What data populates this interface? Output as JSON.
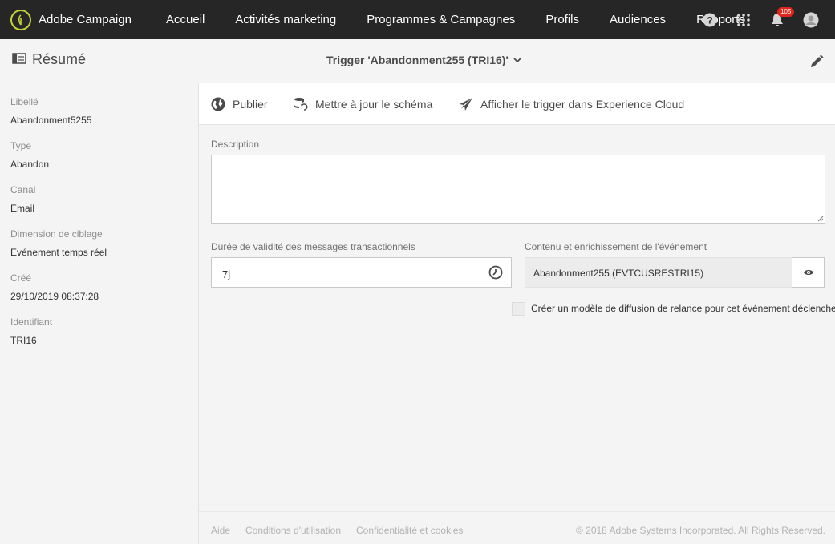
{
  "app": {
    "brand": "Adobe Campaign",
    "nav": [
      "Accueil",
      "Activités marketing",
      "Programmes & Campagnes",
      "Profils",
      "Audiences",
      "Rapports"
    ],
    "notification_count": "105",
    "accent_color": "#c6d23a",
    "badge_color": "#e1251b"
  },
  "header": {
    "summary_label": "Résumé",
    "trigger_title": "Trigger 'Abandonment255 (TRI16)'"
  },
  "sidebar": {
    "fields": [
      {
        "label": "Libellé",
        "value": "Abandonment5255"
      },
      {
        "label": "Type",
        "value": "Abandon"
      },
      {
        "label": "Canal",
        "value": "Email"
      },
      {
        "label": "Dimension de ciblage",
        "value": "Evénement temps réel"
      },
      {
        "label": "Créé",
        "value": "29/10/2019 08:37:28"
      },
      {
        "label": "Identifiant",
        "value": "TRI16"
      }
    ]
  },
  "actions": {
    "publish": "Publier",
    "update_schema": "Mettre à jour le schéma",
    "show_in_cloud": "Afficher le trigger dans Experience Cloud"
  },
  "form": {
    "description_label": "Description",
    "description_value": "",
    "duration_label": "Durée de validité des messages transactionnels",
    "duration_value": "7j",
    "event_label": "Contenu et enrichissement de l'événement",
    "event_value": "Abandonment255 (EVTCUSRESTRI15)",
    "checkbox_label": "Créer un modèle de diffusion de relance pour cet événement déclencheur",
    "checkbox_checked": false
  },
  "footer": {
    "links": [
      "Aide",
      "Conditions d'utilisation",
      "Confidentialité et cookies"
    ],
    "copyright": "© 2018 Adobe Systems Incorporated. All Rights Reserved."
  }
}
